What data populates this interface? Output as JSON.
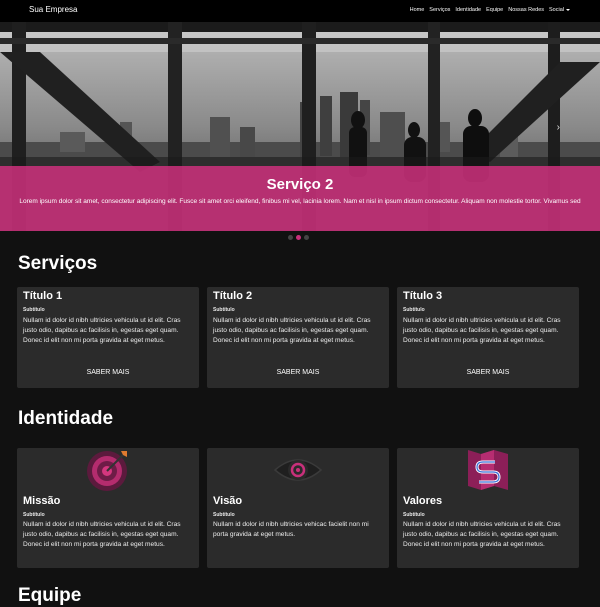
{
  "navbar": {
    "brand": "Sua Empresa",
    "links": [
      "Home",
      "Serviços",
      "Identidade",
      "Equipe",
      "Nossas Redes",
      "Social"
    ]
  },
  "hero": {
    "title": "Serviço 2",
    "text": "Lorem ipsum dolor sit amet, consectetur adipiscing elit. Fusce sit amet orci eleifend, finibus mi vel, lacinia lorem. Nam et nisl in ipsum dictum consectetur. Aliquam non molestie tortor. Vivamus sed",
    "next_icon": "chevron-right-icon",
    "slides": 3,
    "active_slide": 2
  },
  "servicos": {
    "title": "Serviços",
    "cards": [
      {
        "title": "Título 1",
        "subtitle": "Subtítulo",
        "text": "Nullam id dolor id nibh ultricies vehicula ut id elit. Cras justo odio, dapibus ac facilisis in, egestas eget quam. Donec id elit non mi porta gravida at eget metus.",
        "button": "SABER MAIS"
      },
      {
        "title": "Título 2",
        "subtitle": "Subtítulo",
        "text": "Nullam id dolor id nibh ultricies vehicula ut id elit. Cras justo odio, dapibus ac facilisis in, egestas eget quam. Donec id elit non mi porta gravida at eget metus.",
        "button": "SABER MAIS"
      },
      {
        "title": "Título 3",
        "subtitle": "Subtítulo",
        "text": "Nullam id dolor id nibh ultricies vehicula ut id elit. Cras justo odio, dapibus ac facilisis in, egestas eget quam. Donec id elit non mi porta gravida at eget metus.",
        "button": "SABER MAIS"
      }
    ]
  },
  "identidade": {
    "title": "Identidade",
    "cards": [
      {
        "icon": "target-icon",
        "title": "Missão",
        "subtitle": "Subtítulo",
        "text": "Nullam id dolor id nibh ultricies vehicula ut id elit. Cras justo odio, dapibus ac facilisis in, egestas eget quam. Donec id elit non mi porta gravida at eget metus."
      },
      {
        "icon": "eye-icon",
        "title": "Visão",
        "subtitle": "Subtítulo",
        "text": "Nullam id dolor id nibh ultricies vehicac facielit non mi porta gravida at eget metus."
      },
      {
        "icon": "map-route-icon",
        "title": "Valores",
        "subtitle": "Subtítulo",
        "text": "Nullam id dolor id nibh ultricies vehicula ut id elit. Cras justo odio, dapibus ac facilisis in, egestas eget quam. Donec id elit non mi porta gravida at eget metus."
      }
    ]
  },
  "equipe": {
    "title": "Equipe"
  },
  "colors": {
    "accent": "#ce307d",
    "card": "#2b2b2b",
    "background": "#111111"
  }
}
